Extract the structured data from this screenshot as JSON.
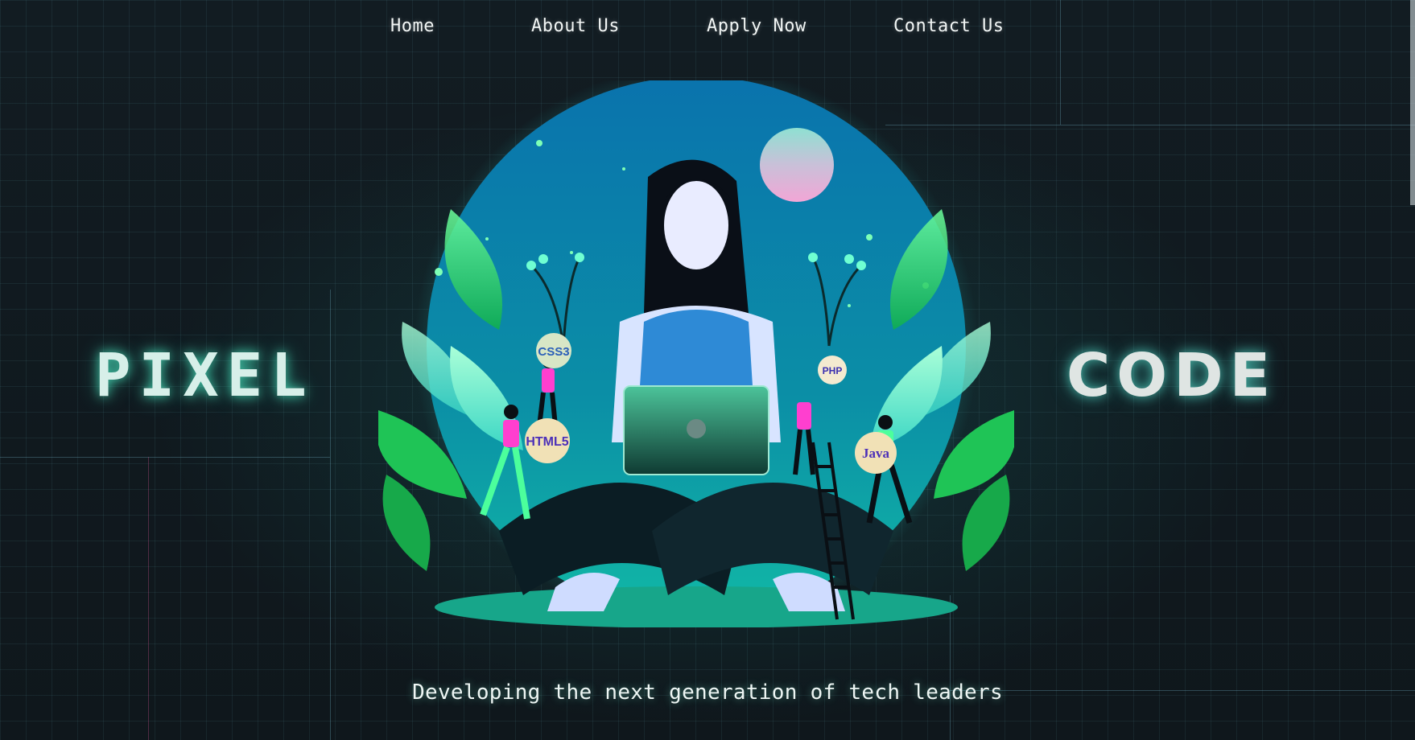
{
  "nav": {
    "items": [
      {
        "label": "Home"
      },
      {
        "label": "About Us"
      },
      {
        "label": "Apply Now"
      },
      {
        "label": "Contact Us"
      }
    ]
  },
  "hero": {
    "left_word": "PIXEL",
    "right_word": "CODE",
    "tagline": "Developing the next generation of tech leaders",
    "badges": [
      "CSS3",
      "HTML5",
      "PHP",
      "Java"
    ]
  },
  "colors": {
    "background": "#101a20",
    "accent_glow": "#50ffd2",
    "circle_top": "#0a6fa8",
    "circle_bottom": "#0fb3a8"
  }
}
